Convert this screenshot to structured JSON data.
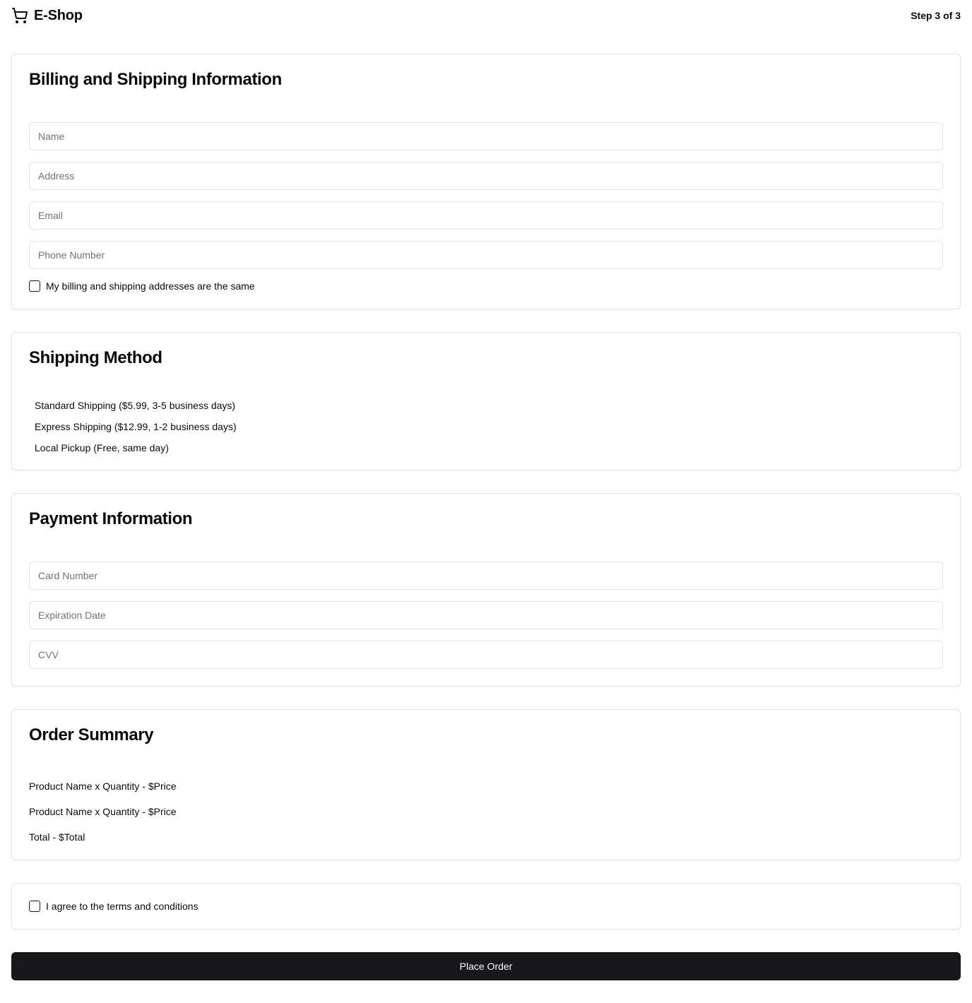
{
  "header": {
    "brand": "E-Shop",
    "brand_icon": "shopping-cart-icon",
    "step": "Step 3 of 3"
  },
  "billing": {
    "title": "Billing and Shipping Information",
    "fields": {
      "name": {
        "value": "",
        "placeholder": "Name"
      },
      "address": {
        "value": "",
        "placeholder": "Address"
      },
      "email": {
        "value": "",
        "placeholder": "Email"
      },
      "phone": {
        "value": "",
        "placeholder": "Phone Number"
      }
    },
    "same_address": {
      "label": "My billing and shipping addresses are the same",
      "checked": false
    }
  },
  "shipping": {
    "title": "Shipping Method",
    "options": [
      {
        "label": "Standard Shipping ($5.99, 3-5 business days)"
      },
      {
        "label": "Express Shipping ($12.99, 1-2 business days)"
      },
      {
        "label": "Local Pickup (Free, same day)"
      }
    ]
  },
  "payment": {
    "title": "Payment Information",
    "fields": {
      "card_number": {
        "value": "",
        "placeholder": "Card Number"
      },
      "expiration": {
        "value": "",
        "placeholder": "Expiration Date"
      },
      "cvv": {
        "value": "",
        "placeholder": "CVV"
      }
    }
  },
  "summary": {
    "title": "Order Summary",
    "items": [
      "Product Name x Quantity - $Price",
      "Product Name x Quantity - $Price"
    ],
    "total": "Total - $Total"
  },
  "terms": {
    "label": "I agree to the terms and conditions",
    "checked": false
  },
  "actions": {
    "place_order": "Place Order"
  },
  "colors": {
    "primary_button": "#18181b",
    "border": "#e4e4e7",
    "placeholder": "#71717a"
  }
}
